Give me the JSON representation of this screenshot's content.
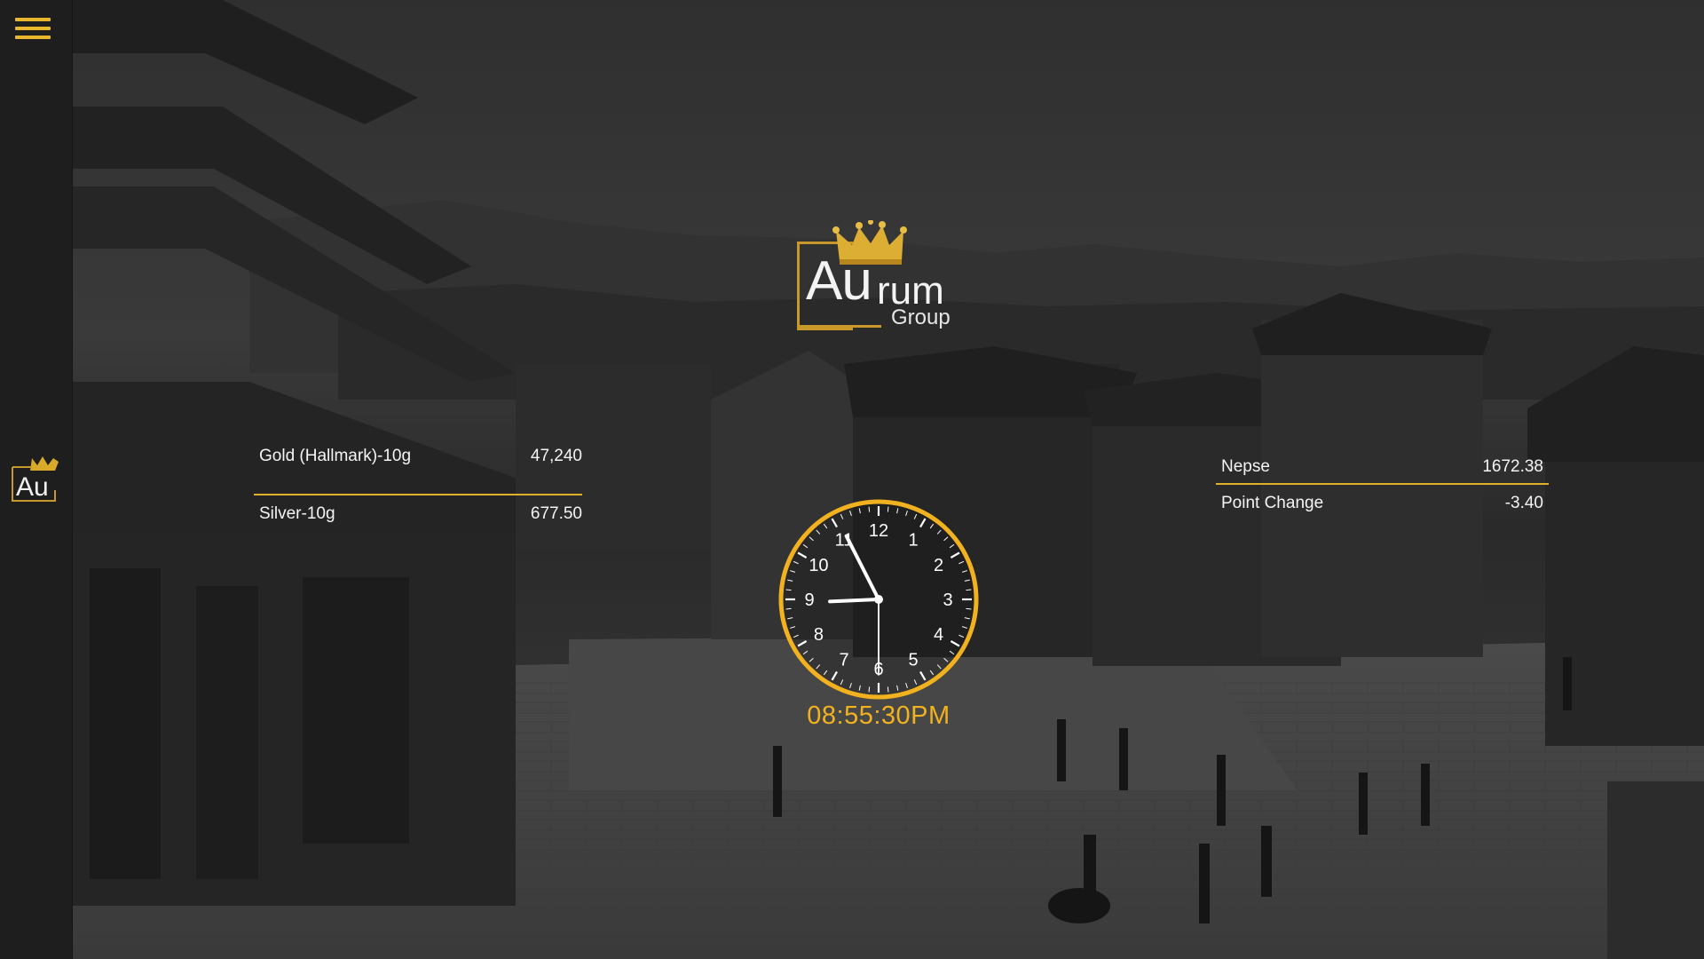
{
  "brand": {
    "au": "Au",
    "rum": "rum",
    "group": "Group",
    "sidebar_mark": "Au"
  },
  "metals": {
    "gold_label": "Gold (Hallmark)-10g",
    "gold_value": "47,240",
    "silver_label": "Silver-10g",
    "silver_value": "677.50"
  },
  "nepse": {
    "index_label": "Nepse",
    "index_value": "1672.38",
    "change_label": "Point Change",
    "change_value": "-3.40"
  },
  "clock": {
    "numbers": [
      "12",
      "1",
      "2",
      "3",
      "4",
      "5",
      "6",
      "7",
      "8",
      "9",
      "10",
      "11"
    ],
    "time_text": "08:55:30PM",
    "hour": 8,
    "minute": 55,
    "second": 30
  },
  "colors": {
    "accent": "#e9b82c",
    "clock_time": "#f2b21f",
    "sidebar": "#1e1e1e"
  },
  "icons": {
    "menu": "hamburger-menu-icon",
    "crown": "crown-icon"
  }
}
